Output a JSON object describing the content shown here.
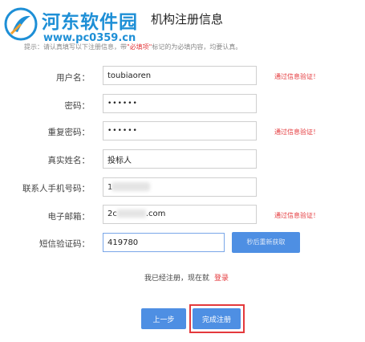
{
  "watermark": {
    "site_name": "河东软件园",
    "site_url": "www.pc0359.cn",
    "brand_color": "#1e8fd6"
  },
  "header": {
    "title": "机构注册信息"
  },
  "notice": {
    "text_before": "提示：请认真填写以下注册信息，带",
    "required_mark": "\"必填项\"",
    "text_after": "标记的为必填内容，均要认真。"
  },
  "form": {
    "username": {
      "label": "用户名：",
      "value": "toubiaoren",
      "validation": "通过信息验证！"
    },
    "password": {
      "label": "密码：",
      "value": "••••••"
    },
    "confirm_password": {
      "label": "重复密码：",
      "value": "••••••",
      "validation": "通过信息验证！"
    },
    "real_name": {
      "label": "真实姓名：",
      "value": "投标人"
    },
    "phone": {
      "label": "联系人手机号码：",
      "value": "1"
    },
    "email": {
      "label": "电子邮箱：",
      "value": "2c",
      "value_suffix": ".com",
      "validation": "通过信息验证！"
    },
    "sms_code": {
      "label": "短信验证码：",
      "value": "419780",
      "button_label": "秒后重新获取"
    }
  },
  "login_prompt": {
    "text": "我已经注册，现在就",
    "link": "登录"
  },
  "actions": {
    "prev_label": "上一步",
    "finish_label": "完成注册"
  },
  "colors": {
    "accent": "#4e8fe3",
    "error_red": "#e4393c"
  }
}
